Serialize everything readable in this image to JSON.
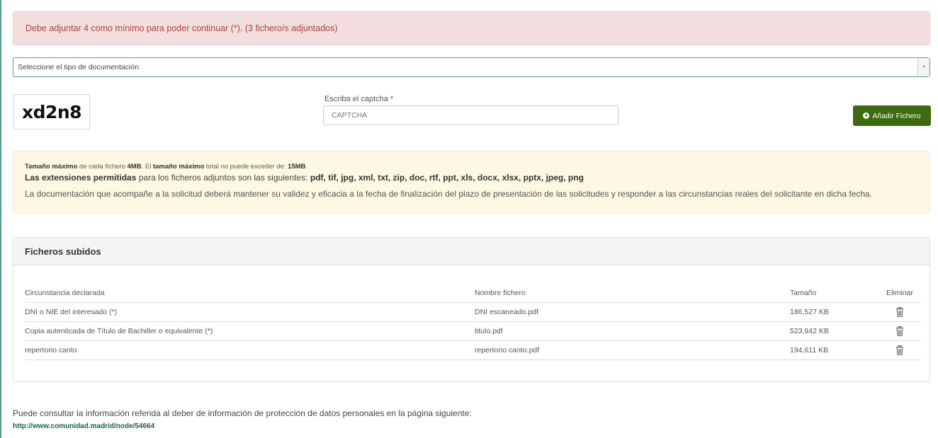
{
  "alert_min_files": "Debe adjuntar 4 como mínimo para poder continuar (*). (3 fichero/s adjuntados)",
  "doc_type_select": {
    "selected": "Seleccione el tipo de documentación",
    "arrow_icon": "▼"
  },
  "captcha": {
    "image_text": "xd2n8",
    "label": "Escriba el captcha *",
    "placeholder": "CAPTCHA"
  },
  "add_file_button": {
    "icon": "plus-circle-icon",
    "icon_glyph": "+",
    "label": "Añadir Fichero"
  },
  "info": {
    "line1_part1": "Tamaño máximo",
    "line1_part2": " de cada fichero ",
    "line1_part3": "4MB",
    "line1_part4": ". El ",
    "line1_part5": "tamaño máximo",
    "line1_part6": " total no puede exceder de: ",
    "line1_part7": "15MB",
    "line1_part8": ".",
    "line2_part1": "Las extensiones permitidas",
    "line2_part2": " para los ficheros adjuntos son las siguientes: ",
    "line2_part3": "pdf, tif, jpg, xml, txt, zip, doc, rtf, ppt, xls, docx, xlsx, pptx, jpeg, png",
    "line3": "La documentación que acompañe a la solicitud deberá mantener su validez y eficacia a la fecha de finalización del plazo de presentación de las solicitudes y responder a las circunstancias reales del solicitante en dicha fecha."
  },
  "uploaded_files": {
    "title": "Ficheros subidos",
    "columns": {
      "circumstance": "Circunstancia declarada",
      "filename": "Nombre fichero",
      "size": "Tamaño",
      "delete": "Eliminar"
    },
    "rows": [
      {
        "circumstance": "DNI o NIE del interesado (*)",
        "filename": "DNI escaneado.pdf",
        "size": "186,527 KB"
      },
      {
        "circumstance": "Copia autenticada de Título de Bachiller o equivalente (*)",
        "filename": "titulo.pdf",
        "size": "523,942 KB"
      },
      {
        "circumstance": "repertorio canto",
        "filename": "repertorio canto.pdf",
        "size": "194,611 KB"
      }
    ]
  },
  "footer": {
    "text": "Puede consultar la información referida al deber de información de protección de datos personales en la página siguiente:",
    "link": "http://www.comunidad.madrid/node/54664"
  },
  "colors": {
    "danger_bg": "#f2dede",
    "warning_bg": "#fcf8e3",
    "button_green": "#3c6b0f",
    "link_teal": "#1f5f58"
  }
}
